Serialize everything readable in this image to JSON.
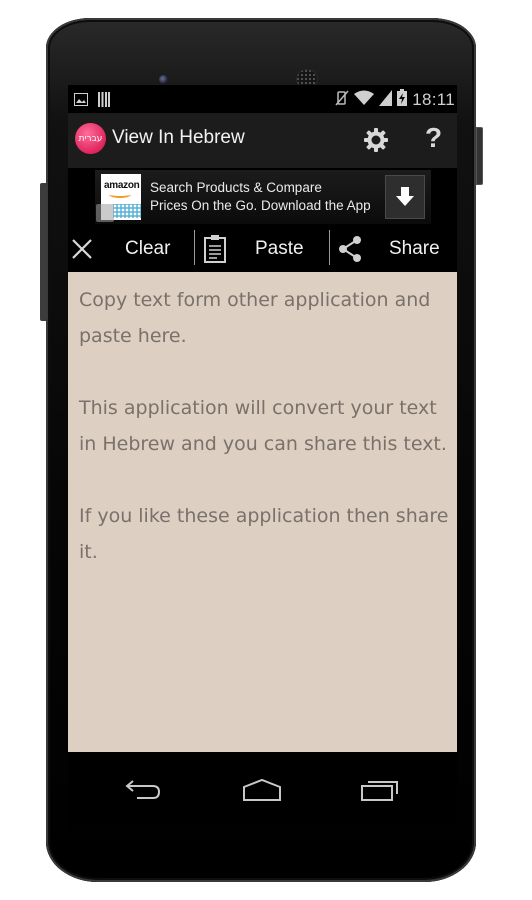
{
  "status_bar": {
    "time": "18:11",
    "left_icons": [
      "gallery-notification-icon",
      "barcode-notification-icon"
    ],
    "right_icons": [
      "vibrate-off-icon",
      "wifi-icon",
      "signal-icon",
      "battery-charging-icon"
    ]
  },
  "app_bar": {
    "logo_text": "עברית",
    "title": "View In Hebrew",
    "actions": [
      "settings",
      "help"
    ],
    "help_label": "?"
  },
  "ad": {
    "brand": "amazon",
    "line1": "Search Products & Compare",
    "line2": "Prices On the Go. Download the App",
    "action": "download"
  },
  "toolbar": {
    "clear_label": "Clear",
    "paste_label": "Paste",
    "share_label": "Share"
  },
  "editor": {
    "text": "Copy text form other application and paste here.\n\nThis application will convert your text in Hebrew and you can share this text.\n\nIf you like these application then share it."
  },
  "nav_bar": {
    "buttons": [
      "back",
      "home",
      "recents"
    ]
  },
  "colors": {
    "app_bar_bg": "#1c1c1c",
    "logo_pink": "#e0245e",
    "editor_bg": "#ddcfc2",
    "editor_text": "#7a716a"
  }
}
